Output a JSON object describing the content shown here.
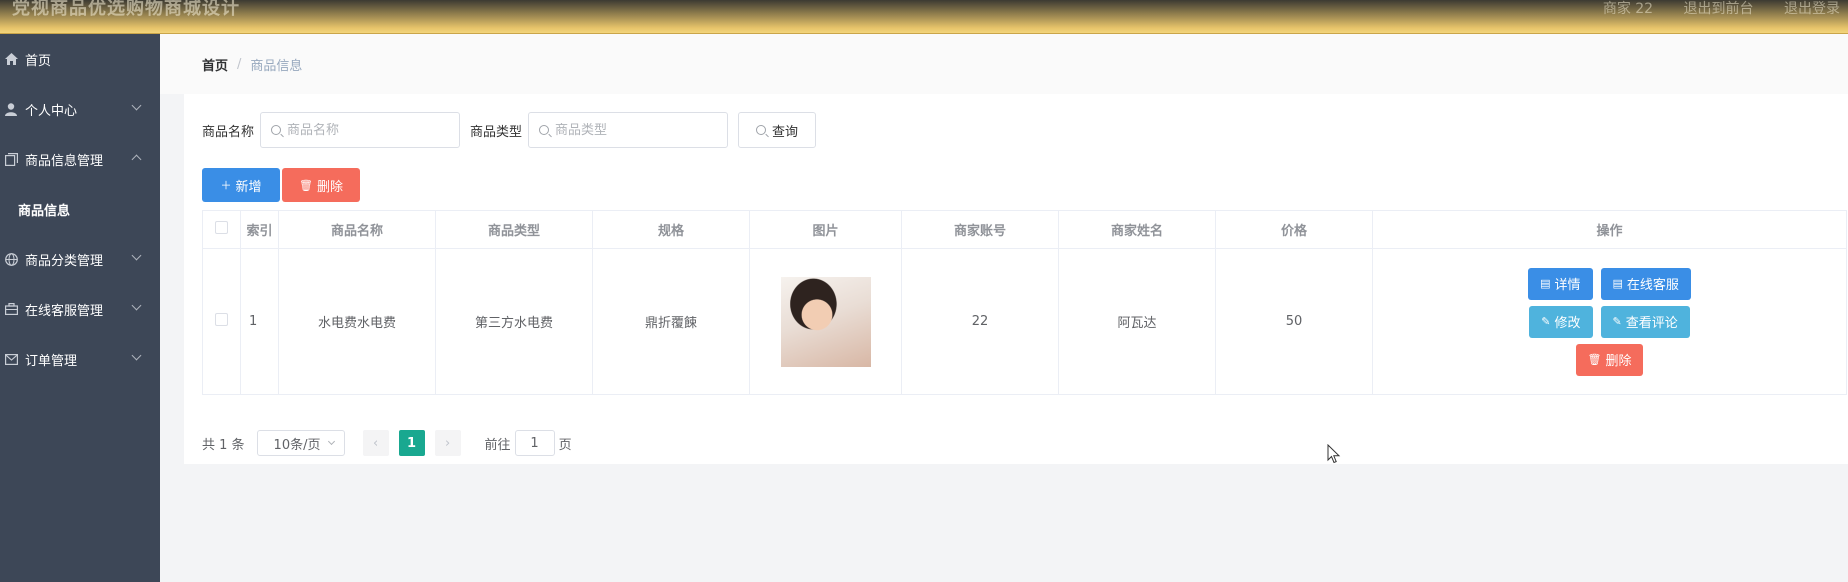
{
  "header": {
    "app_title": "党视商品优选购物商城设计",
    "user_label": "商家 22",
    "back_label": "退出到前台",
    "logout_label": "退出登录"
  },
  "sidebar": {
    "items": [
      {
        "label": "首页",
        "icon": "home-icon"
      },
      {
        "label": "个人中心",
        "icon": "user-icon"
      },
      {
        "label": "商品信息管理",
        "icon": "copy-icon"
      },
      {
        "label": "商品信息",
        "sub": true
      },
      {
        "label": "商品分类管理",
        "icon": "globe-icon"
      },
      {
        "label": "在线客服管理",
        "icon": "briefcase-icon"
      },
      {
        "label": "订单管理",
        "icon": "mail-icon"
      }
    ]
  },
  "breadcrumb": {
    "home": "首页",
    "separator": "/",
    "current": "商品信息"
  },
  "search": {
    "name_label": "商品名称",
    "name_placeholder": "商品名称",
    "type_label": "商品类型",
    "type_placeholder": "商品类型",
    "query_label": "查询"
  },
  "toolbar": {
    "add_label": "新增",
    "delete_label": "删除"
  },
  "table": {
    "headers": [
      "索引",
      "商品名称",
      "商品类型",
      "规格",
      "图片",
      "商家账号",
      "商家姓名",
      "价格",
      "操作"
    ],
    "rows": [
      {
        "index": "1",
        "name": "水电费水电费",
        "type": "第三方水电费",
        "spec": "鼎折覆餗",
        "account": "22",
        "merchant": "阿瓦达",
        "price": "50"
      }
    ],
    "ops": {
      "detail": "详情",
      "service": "在线客服",
      "edit": "修改",
      "review": "查看评论",
      "delete": "删除"
    }
  },
  "pagination": {
    "total": "共 1 条",
    "page_size": "10条/页",
    "current_page": "1",
    "goto_label": "前往",
    "goto_value": "1",
    "page_suffix": "页"
  },
  "colors": {
    "primary": "#3a8ee6",
    "danger": "#f56c5c",
    "info": "#4fb3dd",
    "pager_active": "#19a890",
    "sidebar_bg": "#3d4757"
  }
}
